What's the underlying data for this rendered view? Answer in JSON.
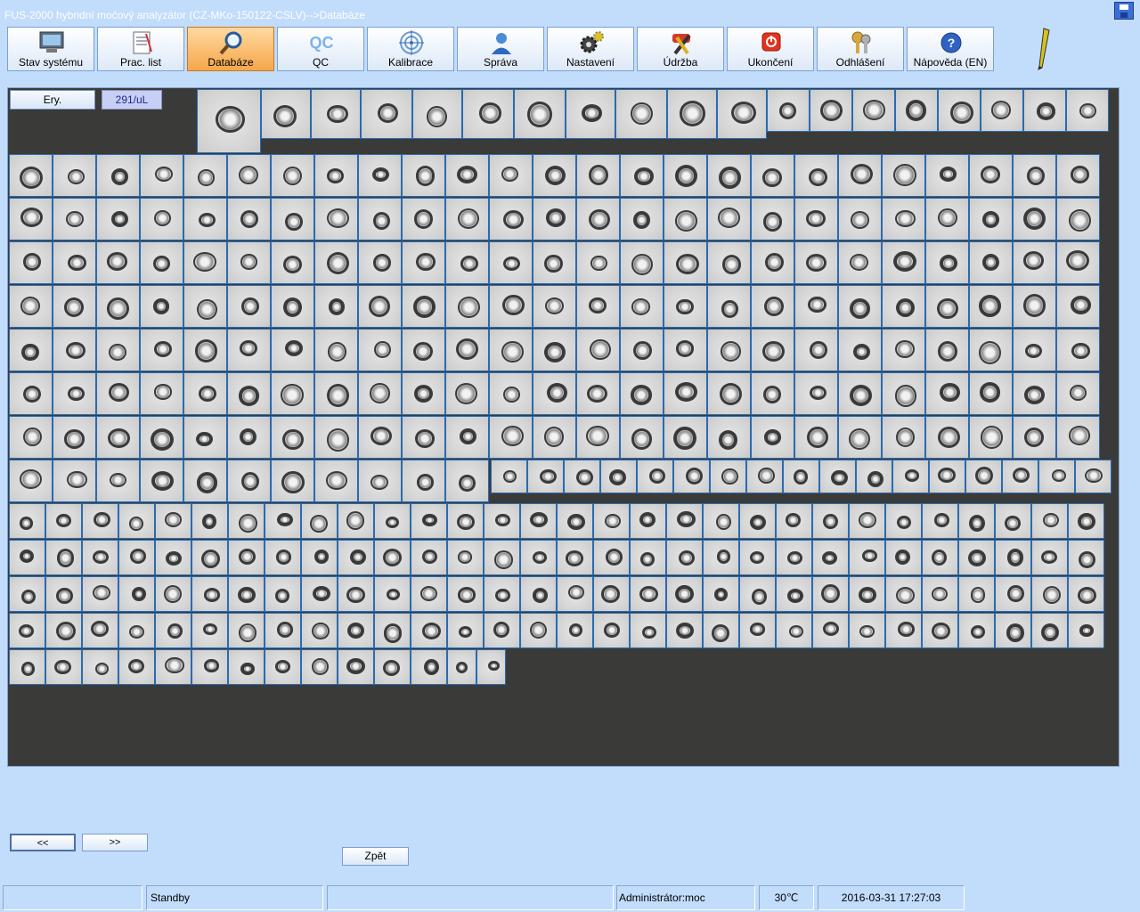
{
  "window": {
    "title": "FUS-2000 hybridní močový analyzátor (CZ-MKo-150122-CSLV)-->Databáze",
    "save_icon": "floppy-disk-icon"
  },
  "toolbar": {
    "buttons": [
      {
        "label": "Stav systému",
        "icon": "monitor-icon",
        "active": false
      },
      {
        "label": "Prac. list",
        "icon": "worklist-icon",
        "active": false
      },
      {
        "label": "Databáze",
        "icon": "magnifier-icon",
        "active": true
      },
      {
        "label": "QC",
        "icon": "qc-text-icon",
        "active": false
      },
      {
        "label": "Kalibrace",
        "icon": "target-icon",
        "active": false
      },
      {
        "label": "Správa",
        "icon": "user-icon",
        "active": false
      },
      {
        "label": "Nastavení",
        "icon": "gears-icon",
        "active": false
      },
      {
        "label": "Údržba",
        "icon": "tools-icon",
        "active": false
      },
      {
        "label": "Ukončení",
        "icon": "power-icon",
        "active": false
      },
      {
        "label": "Odhlášení",
        "icon": "keys-icon",
        "active": false
      },
      {
        "label": "Nápověda (EN)",
        "icon": "help-icon",
        "active": false
      }
    ],
    "extra_icon": "pen-icon"
  },
  "viewer": {
    "class_label": "Ery.",
    "count": "291/uL",
    "cell_image": "red-blood-cell-thumbnail"
  },
  "navigation": {
    "prev_label": "<<",
    "next_label": ">>",
    "back_label": "Zpět"
  },
  "status_bar": {
    "field1": "",
    "state": "Standby",
    "field3": "",
    "user": "Administrátor:moc",
    "temperature": "30℃",
    "datetime": "2016-03-31 17:27:03"
  },
  "colors": {
    "background": "#c2dcfb",
    "viewer_background": "#3a3b39",
    "cell_border": "#2a6ab0",
    "active_tab": "#f5a74a"
  }
}
